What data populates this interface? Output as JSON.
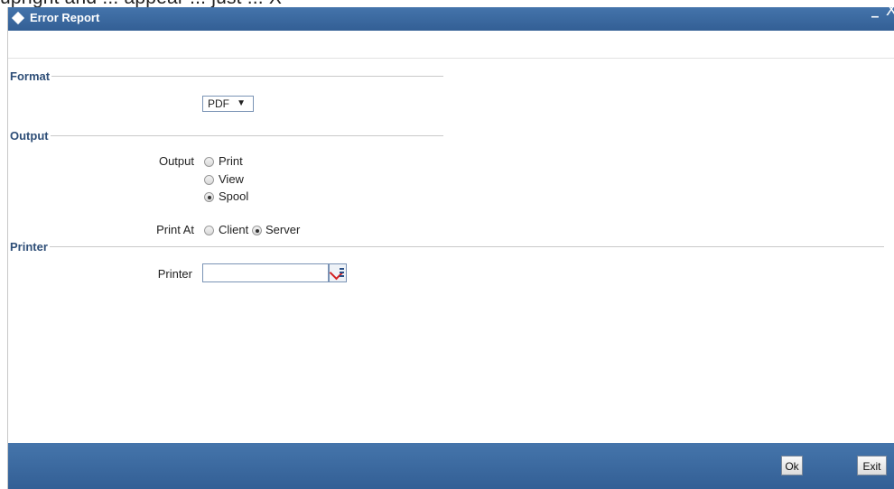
{
  "clipped_header_text": "upright and ... appear ... just ... X",
  "window": {
    "title": "Error Report",
    "minimize_glyph": "–",
    "close_glyph": "X"
  },
  "sections": {
    "format": "Format",
    "output": "Output",
    "printer": "Printer"
  },
  "format": {
    "selected": "PDF",
    "caret": "▼"
  },
  "output": {
    "label": "Output",
    "options": [
      "Print",
      "View",
      "Spool"
    ],
    "selected": "Spool"
  },
  "print_at": {
    "label": "Print At",
    "options": [
      "Client",
      "Server"
    ],
    "selected": "Server"
  },
  "printer": {
    "label": "Printer",
    "value": ""
  },
  "buttons": {
    "ok": "Ok",
    "exit": "Exit"
  },
  "colors": {
    "title_bar": "#3b6aa0",
    "section_label": "#2f4f78",
    "footer": "#3b6aa0"
  }
}
